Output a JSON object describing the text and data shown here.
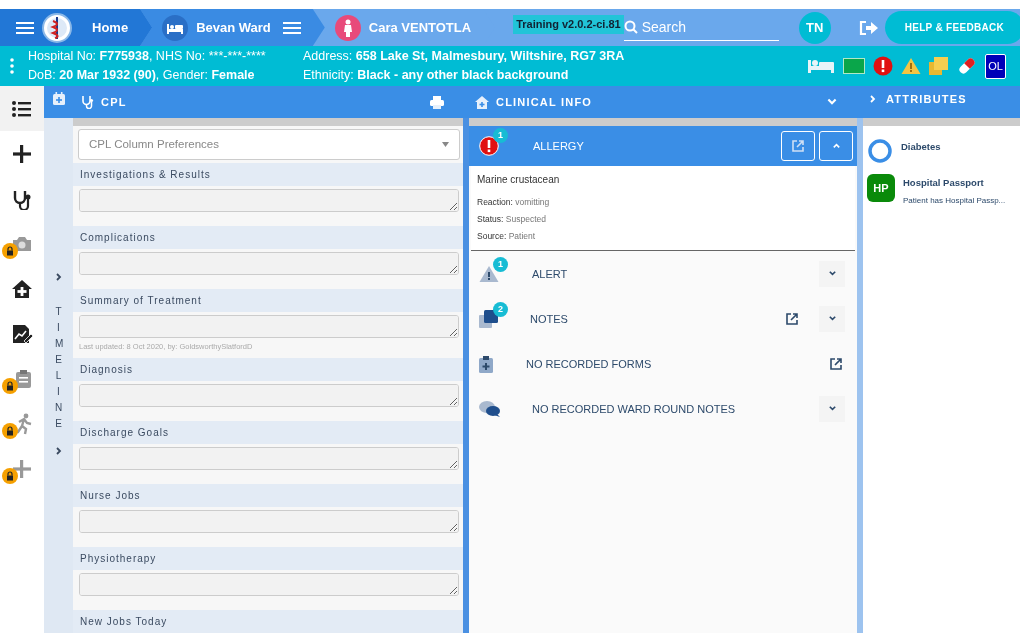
{
  "nav": {
    "segments": [
      {
        "kind": "home",
        "label": "Home",
        "menu": false
      },
      {
        "kind": "ward",
        "label": "Bevan Ward",
        "menu": true
      },
      {
        "kind": "patient",
        "label": "Cara VENTOTLA",
        "menu": false
      }
    ],
    "environment": "Training v2.0.2-ci.81",
    "search": {
      "placeholder": "Search"
    },
    "user_initials": "TN",
    "help_button": "HELP & FEEDBACK"
  },
  "patient_banner": {
    "columns": [
      [
        [
          {
            "text": "Hospital No: ",
            "bold": false
          },
          {
            "text": "F775938",
            "bold": true
          },
          {
            "text": ", NHS No: ***-***-****",
            "bold": false
          }
        ],
        [
          {
            "text": "DoB: ",
            "bold": false
          },
          {
            "text": "20 Mar 1932 (90)",
            "bold": true
          },
          {
            "text": ", Gender: ",
            "bold": false
          },
          {
            "text": "Female",
            "bold": true
          }
        ]
      ],
      [
        [
          {
            "text": "Address: ",
            "bold": false
          },
          {
            "text": "658 Lake St, Malmesbury, Wiltshire, RG7 3RA",
            "bold": true
          }
        ],
        [
          {
            "text": "Ethnicity: ",
            "bold": false
          },
          {
            "text": "Black - any other black background",
            "bold": true
          }
        ]
      ]
    ],
    "flags": [
      {
        "kind": "bed"
      },
      {
        "kind": "card"
      },
      {
        "kind": "allergy"
      },
      {
        "kind": "warning"
      },
      {
        "kind": "notes"
      },
      {
        "kind": "pill"
      },
      {
        "kind": "text",
        "label": "OL"
      }
    ]
  },
  "sidebar": {
    "items": [
      {
        "kind": "list",
        "selected": true,
        "locked": false
      },
      {
        "kind": "plus",
        "selected": false,
        "locked": false
      },
      {
        "kind": "stethoscope",
        "selected": false,
        "locked": false
      },
      {
        "kind": "camera",
        "selected": false,
        "locked": true
      },
      {
        "kind": "home",
        "selected": false,
        "locked": false
      },
      {
        "kind": "chart",
        "selected": false,
        "locked": false
      },
      {
        "kind": "clipboard",
        "selected": false,
        "locked": true
      },
      {
        "kind": "runner",
        "selected": false,
        "locked": true
      },
      {
        "kind": "plus",
        "selected": false,
        "locked": true
      }
    ]
  },
  "timeline": {
    "label": "TIMELINE"
  },
  "cpl": {
    "title": "CPL",
    "preferences_placeholder": "CPL Column Preferences",
    "sections": [
      {
        "label": "Investigations & Results",
        "field": true
      },
      {
        "label": "Complications",
        "field": true
      },
      {
        "label": "Summary of Treatment",
        "field": true,
        "note": "Last updated: 8 Oct 2020, by: GoldsworthySlatfordD"
      },
      {
        "label": "Diagnosis",
        "field": true
      },
      {
        "label": "Discharge Goals",
        "field": true
      },
      {
        "label": "Nurse Jobs",
        "field": true
      },
      {
        "label": "Physiotherapy",
        "field": true
      },
      {
        "label": "New Jobs Today",
        "field": false
      }
    ]
  },
  "clinical_info": {
    "title": "CLINICAL INFO",
    "sections": [
      {
        "kind": "allergy",
        "label": "ALLERGY",
        "count": "1",
        "link": true,
        "expanded": true,
        "details": {
          "name": "Marine crustacean",
          "lines": [
            {
              "label": "Reaction: ",
              "value": "vomitting"
            },
            {
              "label": "Status: ",
              "value": "Suspected"
            },
            {
              "label": "Source: ",
              "value": "Patient"
            }
          ]
        }
      },
      {
        "kind": "alert",
        "label": "ALERT",
        "count": "1",
        "link": false,
        "expanded": false
      },
      {
        "kind": "notes",
        "label": "NOTES",
        "count": "2",
        "link": true,
        "expanded": false
      },
      {
        "kind": "forms",
        "label": "NO RECORDED FORMS",
        "link": true
      },
      {
        "kind": "ward_round",
        "label": "NO RECORDED WARD ROUND NOTES",
        "link": false,
        "expanded": false
      }
    ]
  },
  "attributes": {
    "title": "ATTRIBUTES",
    "items": [
      {
        "kind": "ring",
        "title": "Diabetes"
      },
      {
        "kind": "initials",
        "initials": "HP",
        "title": "Hospital Passport",
        "text": "Patient has Hospital Passp..."
      }
    ]
  }
}
